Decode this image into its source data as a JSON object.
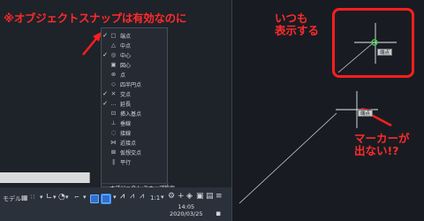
{
  "warning_text": "※オブジェクトスナップは有効なのに",
  "osnap_menu": {
    "items": [
      {
        "checked": true,
        "icon": "endpoint-icon",
        "glyph": "□",
        "label": "端点"
      },
      {
        "checked": false,
        "icon": "midpoint-icon",
        "glyph": "△",
        "label": "中点"
      },
      {
        "checked": true,
        "icon": "center-icon",
        "glyph": "◎",
        "label": "中心"
      },
      {
        "checked": false,
        "icon": "geom-center-icon",
        "glyph": "▣",
        "label": "図心"
      },
      {
        "checked": false,
        "icon": "node-icon",
        "glyph": "⊗",
        "label": "点"
      },
      {
        "checked": false,
        "icon": "quadrant-icon",
        "glyph": "◇",
        "label": "四半円点"
      },
      {
        "checked": true,
        "icon": "intersection-icon",
        "glyph": "✕",
        "label": "交点"
      },
      {
        "checked": true,
        "icon": "extension-icon",
        "glyph": "…",
        "label": "延長"
      },
      {
        "checked": false,
        "icon": "insertion-icon",
        "glyph": "⊡",
        "label": "挿入基点"
      },
      {
        "checked": false,
        "icon": "perpendicular-icon",
        "glyph": "⊥",
        "label": "垂線"
      },
      {
        "checked": false,
        "icon": "tangent-icon",
        "glyph": "◌",
        "label": "接線"
      },
      {
        "checked": false,
        "icon": "nearest-icon",
        "glyph": "⋈",
        "label": "近接点"
      },
      {
        "checked": false,
        "icon": "apparent-int-icon",
        "glyph": "⊠",
        "label": "仮想交点"
      },
      {
        "checked": false,
        "icon": "parallel-icon",
        "glyph": "∥",
        "label": "平行"
      }
    ],
    "settings_label": "オブジェクト スナップ設定..."
  },
  "statusbar": {
    "model_label": "モデル",
    "scale_label": "1:1",
    "time": "14:05",
    "date": "2020/03/25"
  },
  "right": {
    "annot_top_line1": "いつも",
    "annot_top_line2": "表示する",
    "tooltip_top": "端点",
    "tooltip_bottom": "端点",
    "annot_bottom_line1": "マーカーが",
    "annot_bottom_line2": "出ない!?"
  },
  "colors": {
    "annotation_red": "#ff2a2a",
    "snap_marker_green": "#39d24a"
  }
}
